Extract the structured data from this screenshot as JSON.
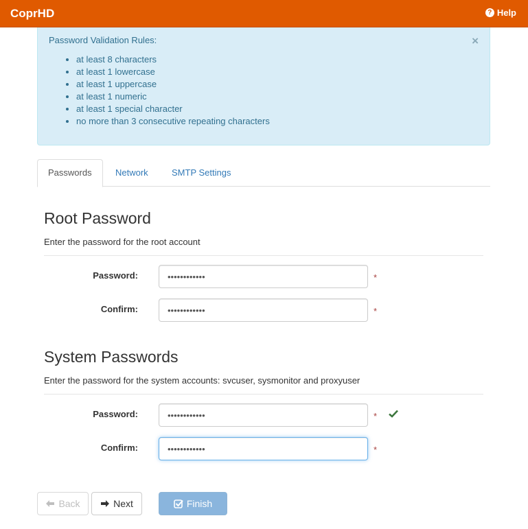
{
  "header": {
    "brand": "CoprHD",
    "help_label": "Help"
  },
  "alert": {
    "title": "Password Validation Rules:",
    "close": "×",
    "rules": [
      "at least 8 characters",
      "at least 1 lowercase",
      "at least 1 uppercase",
      "at least 1 numeric",
      "at least 1 special character",
      "no more than 3 consecutive repeating characters"
    ]
  },
  "tabs": [
    {
      "label": "Passwords",
      "active": true
    },
    {
      "label": "Network",
      "active": false
    },
    {
      "label": "SMTP Settings",
      "active": false
    }
  ],
  "root_section": {
    "title": "Root Password",
    "description": "Enter the password for the root account",
    "password_label": "Password:",
    "password_value": "••••••••••••",
    "confirm_label": "Confirm:",
    "confirm_value": "••••••••••••",
    "required_mark": "*"
  },
  "system_section": {
    "title": "System Passwords",
    "description": "Enter the password for the system accounts: svcuser, sysmonitor and proxyuser",
    "password_label": "Password:",
    "password_value": "••••••••••••",
    "confirm_label": "Confirm:",
    "confirm_value": "••••••••••••",
    "required_mark": "*",
    "valid_icon": "check-icon"
  },
  "buttons": {
    "back": "Back",
    "next": "Next",
    "finish": "Finish"
  },
  "colors": {
    "navbar": "#e05a00",
    "alert_bg": "#d9edf7",
    "alert_text": "#31708f",
    "link": "#337ab7",
    "required": "#a94442",
    "valid": "#3c763d",
    "finish_bg": "#8ab5dd"
  }
}
